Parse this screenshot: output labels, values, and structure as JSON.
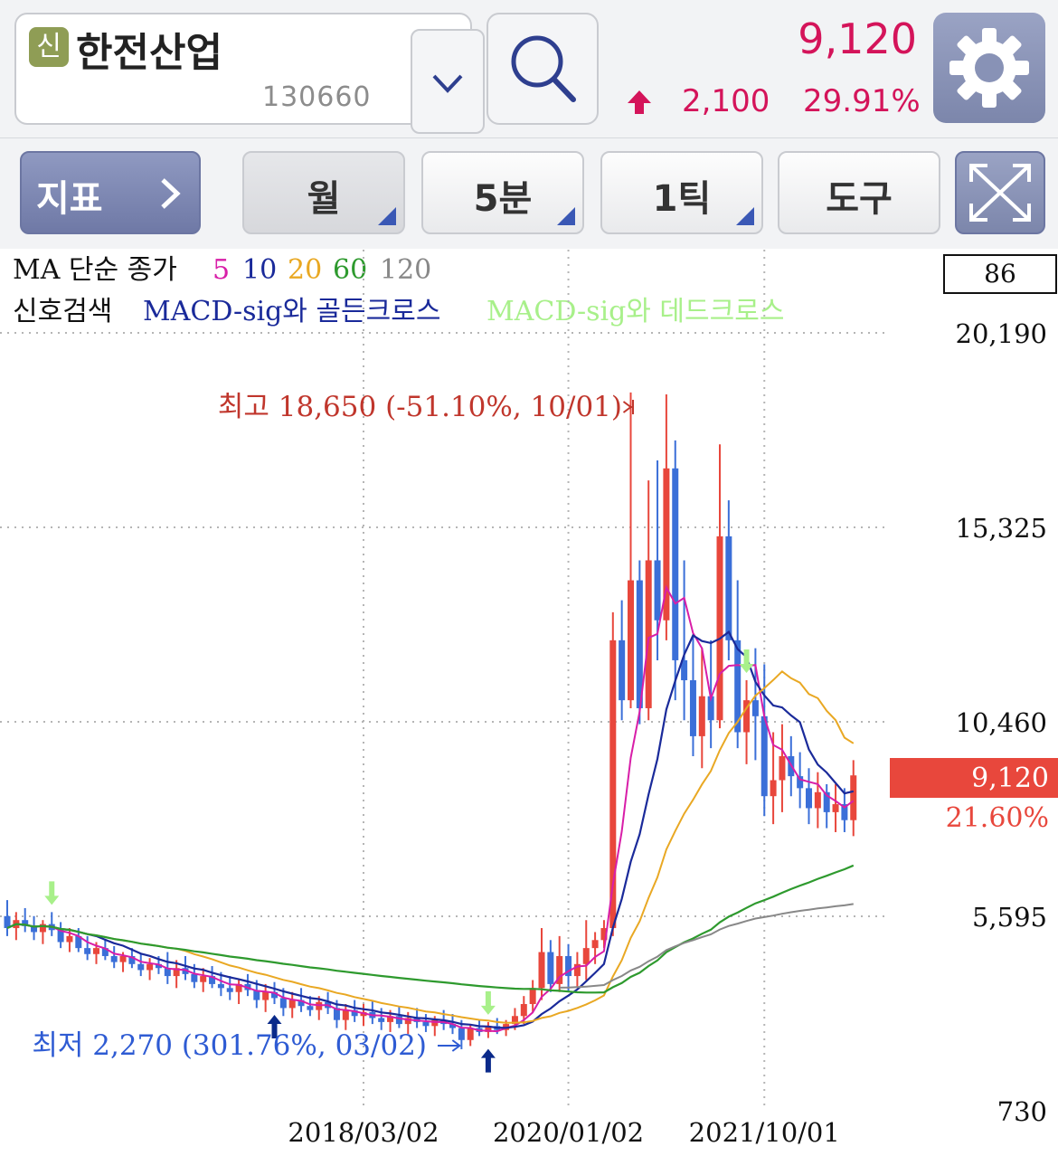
{
  "header": {
    "badge": "신",
    "stock_name": "한전산업",
    "stock_code": "130660",
    "price": "9,120",
    "change_value": "2,100",
    "change_percent": "29.91%",
    "up_color": "#d4145a"
  },
  "toolbar": {
    "indicator_label": "지표",
    "period_label": "월",
    "minute_label": "5분",
    "tick_label": "1틱",
    "tools_label": "도구"
  },
  "legend": {
    "ma_label": "MA 단순 종가",
    "ma_periods": [
      {
        "label": "5",
        "color": "#d81ea8"
      },
      {
        "label": "10",
        "color": "#1a2a9a"
      },
      {
        "label": "20",
        "color": "#e9a823"
      },
      {
        "label": "60",
        "color": "#2e9a2e"
      },
      {
        "label": "120",
        "color": "#888888"
      }
    ],
    "signal_label": "신호검색",
    "signal_golden": "MACD-sig와 골든크로스",
    "signal_dead": "MACD-sig와 데드크로스",
    "golden_color": "#1a2a9a",
    "dead_color": "#a8f08a"
  },
  "chart_data": {
    "type": "candlestick",
    "period": "monthly",
    "y_axis_ticks": [
      "20,190",
      "15,325",
      "10,460",
      "5,595",
      "730"
    ],
    "y_ticks_values": [
      20190,
      15325,
      10460,
      5595,
      730
    ],
    "x_axis_ticks": [
      "2018/03/02",
      "2020/01/02",
      "2021/10/01"
    ],
    "x_ticks_index": [
      40,
      63,
      85
    ],
    "top_box_value": "86",
    "current_price_label": "9,120",
    "current_price": 9120,
    "current_ratio_label": "21.60%",
    "high_annotation": "최고 18,650 (-51.10%, 10/01)",
    "low_annotation": "최저 2,270 (301.76%, 03/02)",
    "candles": [
      {
        "o": 5600,
        "h": 6000,
        "l": 5100,
        "c": 5300
      },
      {
        "o": 5300,
        "h": 5700,
        "l": 5000,
        "c": 5500
      },
      {
        "o": 5500,
        "h": 5800,
        "l": 5200,
        "c": 5350
      },
      {
        "o": 5350,
        "h": 5600,
        "l": 5000,
        "c": 5200
      },
      {
        "o": 5200,
        "h": 5500,
        "l": 4900,
        "c": 5400
      },
      {
        "o": 5400,
        "h": 5700,
        "l": 5100,
        "c": 5250
      },
      {
        "o": 5250,
        "h": 5450,
        "l": 4800,
        "c": 4950
      },
      {
        "o": 4950,
        "h": 5300,
        "l": 4700,
        "c": 5100
      },
      {
        "o": 5100,
        "h": 5300,
        "l": 4700,
        "c": 4800
      },
      {
        "o": 4800,
        "h": 5100,
        "l": 4500,
        "c": 4650
      },
      {
        "o": 4650,
        "h": 4950,
        "l": 4400,
        "c": 4800
      },
      {
        "o": 4800,
        "h": 5000,
        "l": 4500,
        "c": 4600
      },
      {
        "o": 4600,
        "h": 4850,
        "l": 4300,
        "c": 4450
      },
      {
        "o": 4450,
        "h": 4700,
        "l": 4200,
        "c": 4600
      },
      {
        "o": 4600,
        "h": 4800,
        "l": 4300,
        "c": 4400
      },
      {
        "o": 4400,
        "h": 4650,
        "l": 4100,
        "c": 4250
      },
      {
        "o": 4250,
        "h": 4550,
        "l": 4000,
        "c": 4400
      },
      {
        "o": 4400,
        "h": 4600,
        "l": 4150,
        "c": 4300
      },
      {
        "o": 4300,
        "h": 4700,
        "l": 3900,
        "c": 4100
      },
      {
        "o": 4100,
        "h": 4500,
        "l": 3800,
        "c": 4300
      },
      {
        "o": 4300,
        "h": 4600,
        "l": 4000,
        "c": 4150
      },
      {
        "o": 4150,
        "h": 4400,
        "l": 3800,
        "c": 3950
      },
      {
        "o": 3950,
        "h": 4300,
        "l": 3700,
        "c": 4100
      },
      {
        "o": 4100,
        "h": 4350,
        "l": 3800,
        "c": 3900
      },
      {
        "o": 3900,
        "h": 4200,
        "l": 3600,
        "c": 3800
      },
      {
        "o": 3800,
        "h": 4100,
        "l": 3500,
        "c": 3700
      },
      {
        "o": 3700,
        "h": 4000,
        "l": 3400,
        "c": 3900
      },
      {
        "o": 3900,
        "h": 4150,
        "l": 3600,
        "c": 3750
      },
      {
        "o": 3750,
        "h": 4000,
        "l": 3300,
        "c": 3500
      },
      {
        "o": 3500,
        "h": 3900,
        "l": 3200,
        "c": 3700
      },
      {
        "o": 3700,
        "h": 3950,
        "l": 3400,
        "c": 3550
      },
      {
        "o": 3550,
        "h": 3800,
        "l": 3100,
        "c": 3300
      },
      {
        "o": 3300,
        "h": 3700,
        "l": 3050,
        "c": 3500
      },
      {
        "o": 3500,
        "h": 3800,
        "l": 3200,
        "c": 3350
      },
      {
        "o": 3350,
        "h": 3600,
        "l": 3100,
        "c": 3250
      },
      {
        "o": 3250,
        "h": 3600,
        "l": 3000,
        "c": 3450
      },
      {
        "o": 3450,
        "h": 3700,
        "l": 3150,
        "c": 3300
      },
      {
        "o": 3300,
        "h": 3500,
        "l": 2800,
        "c": 3000
      },
      {
        "o": 3000,
        "h": 3400,
        "l": 2750,
        "c": 3250
      },
      {
        "o": 3250,
        "h": 3500,
        "l": 2950,
        "c": 3100
      },
      {
        "o": 3100,
        "h": 3400,
        "l": 2850,
        "c": 3200
      },
      {
        "o": 3200,
        "h": 3500,
        "l": 2900,
        "c": 3050
      },
      {
        "o": 3050,
        "h": 3300,
        "l": 2750,
        "c": 2950
      },
      {
        "o": 2950,
        "h": 3250,
        "l": 2700,
        "c": 3100
      },
      {
        "o": 3100,
        "h": 3350,
        "l": 2800,
        "c": 2900
      },
      {
        "o": 2900,
        "h": 3200,
        "l": 2650,
        "c": 3050
      },
      {
        "o": 3050,
        "h": 3300,
        "l": 2800,
        "c": 2950
      },
      {
        "o": 2950,
        "h": 3150,
        "l": 2700,
        "c": 2850
      },
      {
        "o": 2850,
        "h": 3100,
        "l": 2600,
        "c": 3000
      },
      {
        "o": 3000,
        "h": 3250,
        "l": 2750,
        "c": 2900
      },
      {
        "o": 2900,
        "h": 3150,
        "l": 2650,
        "c": 2800
      },
      {
        "o": 2800,
        "h": 3000,
        "l": 2270,
        "c": 2500
      },
      {
        "o": 2500,
        "h": 2900,
        "l": 2350,
        "c": 2800
      },
      {
        "o": 2800,
        "h": 3000,
        "l": 2600,
        "c": 2700
      },
      {
        "o": 2700,
        "h": 2950,
        "l": 2550,
        "c": 2850
      },
      {
        "o": 2850,
        "h": 3050,
        "l": 2650,
        "c": 2750
      },
      {
        "o": 2750,
        "h": 3000,
        "l": 2600,
        "c": 2900
      },
      {
        "o": 2900,
        "h": 3300,
        "l": 2750,
        "c": 3100
      },
      {
        "o": 3100,
        "h": 3600,
        "l": 2900,
        "c": 3400
      },
      {
        "o": 3400,
        "h": 4000,
        "l": 3200,
        "c": 3800
      },
      {
        "o": 3800,
        "h": 5300,
        "l": 3500,
        "c": 4700
      },
      {
        "o": 4700,
        "h": 5000,
        "l": 3700,
        "c": 3900
      },
      {
        "o": 3900,
        "h": 5100,
        "l": 3700,
        "c": 4600
      },
      {
        "o": 4600,
        "h": 4900,
        "l": 3700,
        "c": 4100
      },
      {
        "o": 4100,
        "h": 4700,
        "l": 3800,
        "c": 4400
      },
      {
        "o": 4400,
        "h": 5500,
        "l": 4000,
        "c": 4800
      },
      {
        "o": 4800,
        "h": 5200,
        "l": 4400,
        "c": 5000
      },
      {
        "o": 5000,
        "h": 5500,
        "l": 4800,
        "c": 5300
      },
      {
        "o": 5300,
        "h": 13200,
        "l": 5100,
        "c": 12500
      },
      {
        "o": 12500,
        "h": 13500,
        "l": 10500,
        "c": 11000
      },
      {
        "o": 11000,
        "h": 18700,
        "l": 10800,
        "c": 14000
      },
      {
        "o": 14000,
        "h": 14500,
        "l": 10400,
        "c": 10800
      },
      {
        "o": 10800,
        "h": 16500,
        "l": 10500,
        "c": 14500
      },
      {
        "o": 14500,
        "h": 17000,
        "l": 12000,
        "c": 13000
      },
      {
        "o": 13000,
        "h": 18650,
        "l": 12500,
        "c": 16800
      },
      {
        "o": 16800,
        "h": 17500,
        "l": 11000,
        "c": 12000
      },
      {
        "o": 12000,
        "h": 14500,
        "l": 10500,
        "c": 11500
      },
      {
        "o": 11500,
        "h": 12600,
        "l": 9600,
        "c": 10100
      },
      {
        "o": 10100,
        "h": 12300,
        "l": 9300,
        "c": 11100
      },
      {
        "o": 11100,
        "h": 12500,
        "l": 9800,
        "c": 10500
      },
      {
        "o": 10500,
        "h": 17400,
        "l": 10300,
        "c": 15100
      },
      {
        "o": 15100,
        "h": 16000,
        "l": 12000,
        "c": 12500
      },
      {
        "o": 12500,
        "h": 14000,
        "l": 9800,
        "c": 10200
      },
      {
        "o": 10200,
        "h": 11500,
        "l": 9400,
        "c": 11000
      },
      {
        "o": 11000,
        "h": 12300,
        "l": 9500,
        "c": 10600
      },
      {
        "o": 10600,
        "h": 11900,
        "l": 8100,
        "c": 8600
      },
      {
        "o": 8600,
        "h": 10200,
        "l": 7900,
        "c": 9000
      },
      {
        "o": 9000,
        "h": 10400,
        "l": 8200,
        "c": 9600
      },
      {
        "o": 9600,
        "h": 10100,
        "l": 8600,
        "c": 9100
      },
      {
        "o": 9100,
        "h": 9700,
        "l": 8300,
        "c": 8800
      },
      {
        "o": 8800,
        "h": 9300,
        "l": 7900,
        "c": 8300
      },
      {
        "o": 8300,
        "h": 9200,
        "l": 7800,
        "c": 8700
      },
      {
        "o": 8700,
        "h": 8900,
        "l": 7800,
        "c": 8200
      },
      {
        "o": 8200,
        "h": 8900,
        "l": 7700,
        "c": 8400
      },
      {
        "o": 8400,
        "h": 8800,
        "l": 7700,
        "c": 8000
      },
      {
        "o": 8000,
        "h": 9500,
        "l": 7600,
        "c": 9120
      }
    ],
    "ma_series": [
      {
        "name": "5",
        "color": "#d81ea8",
        "width": 2
      },
      {
        "name": "10",
        "color": "#1a2a9a",
        "width": 2.2
      },
      {
        "name": "20",
        "color": "#e9a823",
        "width": 2
      },
      {
        "name": "60",
        "color": "#2e9a2e",
        "width": 2.2
      },
      {
        "name": "120",
        "color": "#888888",
        "width": 2
      }
    ],
    "golden_signals": [
      30,
      54
    ],
    "dead_signals": [
      5,
      54,
      83
    ]
  }
}
